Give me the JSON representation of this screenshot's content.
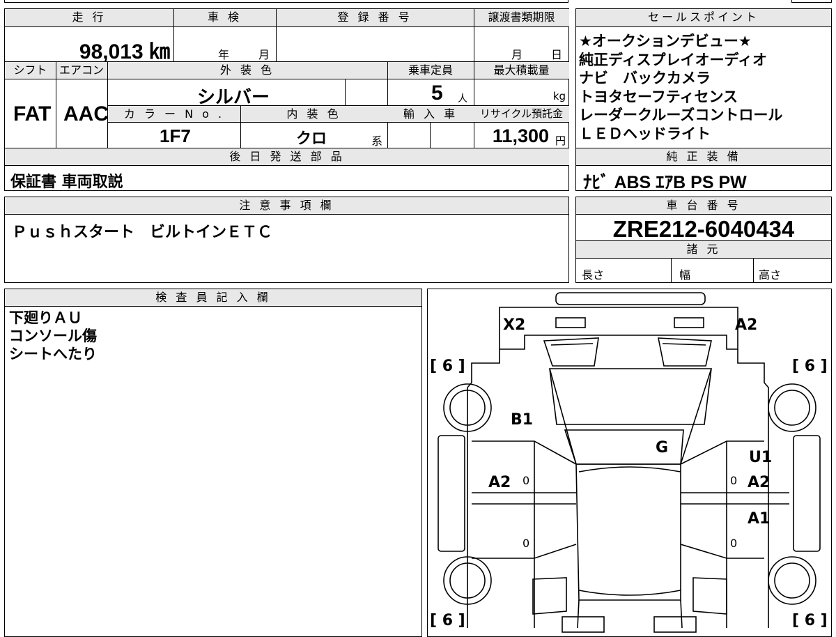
{
  "vehicle": {
    "mileage_label": "走 行",
    "mileage": "98,013 ㎞",
    "inspection_label": "車 検",
    "inspection_year": "年",
    "inspection_month": "月",
    "registration_label": "登 録 番 号",
    "transfer_deadline_label": "譲渡書類期限",
    "transfer_month": "月",
    "transfer_day": "日",
    "shift_label": "シフト",
    "shift": "FAT",
    "ac_label": "エアコン",
    "ac": "AAC",
    "exterior_color_label": "外 装 色",
    "exterior_color": "シルバー",
    "capacity_label": "乗車定員",
    "capacity": "5",
    "capacity_unit": "人",
    "max_load_label": "最大積載量",
    "max_load_unit": "kg",
    "color_no_label": "カ ラ ー N o .",
    "color_no": "1F7",
    "interior_color_label": "内 装 色",
    "interior_color": "クロ",
    "interior_suffix": "系",
    "import_label": "輸 入 車",
    "recycle_label": "リサイクル預託金",
    "recycle_fee": "11,300",
    "recycle_unit": "円"
  },
  "sales_points": {
    "label": "セールスポイント",
    "items": [
      "★オークションデビュー★",
      "純正ディスプレイオーディオ",
      "ナビ　バックカメラ",
      "トヨタセーフティセンス",
      "レーダークルーズコントロール",
      "ＬＥＤヘッドライト"
    ]
  },
  "later_parts": {
    "label": "後 日 発 送 部 品",
    "value": "保証書 車両取説"
  },
  "equipment": {
    "label": "純 正 装 備",
    "value": "ﾅﾋﾞ ABS ｴｱB PS PW"
  },
  "notes": {
    "label": "注 意 事 項 欄",
    "value": "Ｐｕｓｈスタート　ビルトインＥＴＣ"
  },
  "chassis": {
    "label": "車 台 番 号",
    "value": "ZRE212-6040434"
  },
  "specs": {
    "label": "諸 元",
    "length_label": "長さ",
    "width_label": "幅",
    "height_label": "高さ"
  },
  "inspector": {
    "label": "検 査 員 記 入 欄",
    "lines": [
      "下廻りＡＵ",
      "コンソール傷",
      "シートへたり"
    ]
  },
  "diagram": {
    "marks": {
      "front_left": "X2",
      "front_right": "A2",
      "left_front_fender": "B1",
      "center": "G",
      "right_front_door_1": "U1",
      "right_front_door_2": "A2",
      "left_front_door": "A2",
      "right_rear_door": "A1"
    },
    "tires": {
      "front_left": "[ 6 ]",
      "front_right": "[ 6 ]",
      "rear_left": "[ 6 ]",
      "rear_right": "[ 6 ]"
    },
    "door_zeros": [
      "0",
      "0",
      "0",
      "0"
    ]
  }
}
